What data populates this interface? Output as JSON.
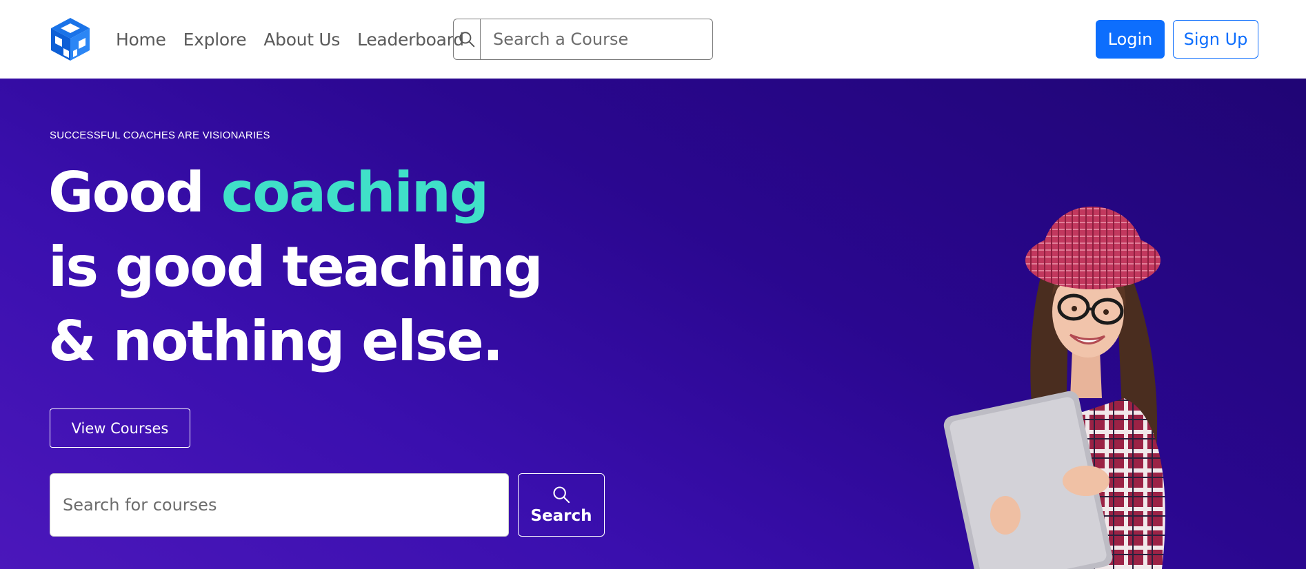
{
  "nav": {
    "logo_icon": "cube-logo-icon",
    "links": [
      {
        "label": "Home"
      },
      {
        "label": "Explore"
      },
      {
        "label": "About Us"
      },
      {
        "label": "Leaderboard"
      }
    ],
    "search": {
      "icon": "search-icon",
      "placeholder": "Search a Course"
    },
    "login_label": "Login",
    "signup_label": "Sign Up",
    "accent_color": "#0d6efd"
  },
  "hero": {
    "eyebrow": "SUCCESSFUL COACHES ARE VISIONARIES",
    "headline": {
      "part1": "Good ",
      "accent": "coaching",
      "part2": " is good teaching & nothing else."
    },
    "accent_color": "#40e0c8",
    "view_courses_label": "View Courses",
    "search": {
      "placeholder": "Search for courses",
      "button_label": "Search",
      "button_icon": "search-icon"
    }
  }
}
